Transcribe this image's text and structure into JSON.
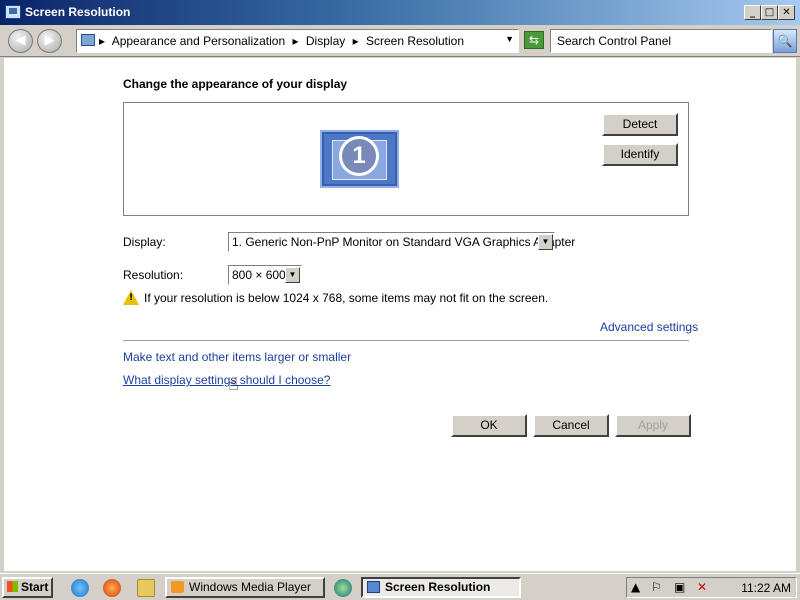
{
  "window": {
    "title": "Screen Resolution",
    "min_label": "_",
    "max_label": "□",
    "close_label": "✕"
  },
  "nav": {
    "back_glyph": "◀",
    "forward_glyph": "▶"
  },
  "address": {
    "crumbs": [
      "Appearance and Personalization",
      "Display",
      "Screen Resolution"
    ],
    "separator": "▸",
    "dropdown_glyph": "▼",
    "refresh_glyph": "⇆"
  },
  "search": {
    "placeholder": "Search Control Panel",
    "button_glyph": "🔍"
  },
  "main": {
    "heading": "Change the appearance of your display",
    "monitor_number": "1",
    "detect_label": "Detect",
    "identify_label": "Identify",
    "display_label": "Display:",
    "display_value": "1. Generic Non-PnP Monitor on Standard VGA Graphics Adapter",
    "resolution_label": "Resolution:",
    "resolution_value": "800 × 600",
    "warning_text": "If your resolution is below 1024 x 768, some items may not fit on the screen.",
    "advanced_link": "Advanced settings",
    "text_size_link": "Make text and other items larger or smaller",
    "help_link": "What display settings should I choose?",
    "ok_label": "OK",
    "cancel_label": "Cancel",
    "apply_label": "Apply"
  },
  "taskbar": {
    "start_label": "Start",
    "items": [
      {
        "label": "Windows Media Player",
        "active": false
      },
      {
        "label": "Screen Resolution",
        "active": true
      }
    ],
    "clock": "11:22 AM",
    "icons": [
      "ie-icon",
      "firefox-icon",
      "folder-icon",
      "media-icon"
    ]
  },
  "colors": {
    "accent_titlebar": "#0a246a",
    "link": "#1a3fa0",
    "window_bg": "#d4d0c8"
  }
}
